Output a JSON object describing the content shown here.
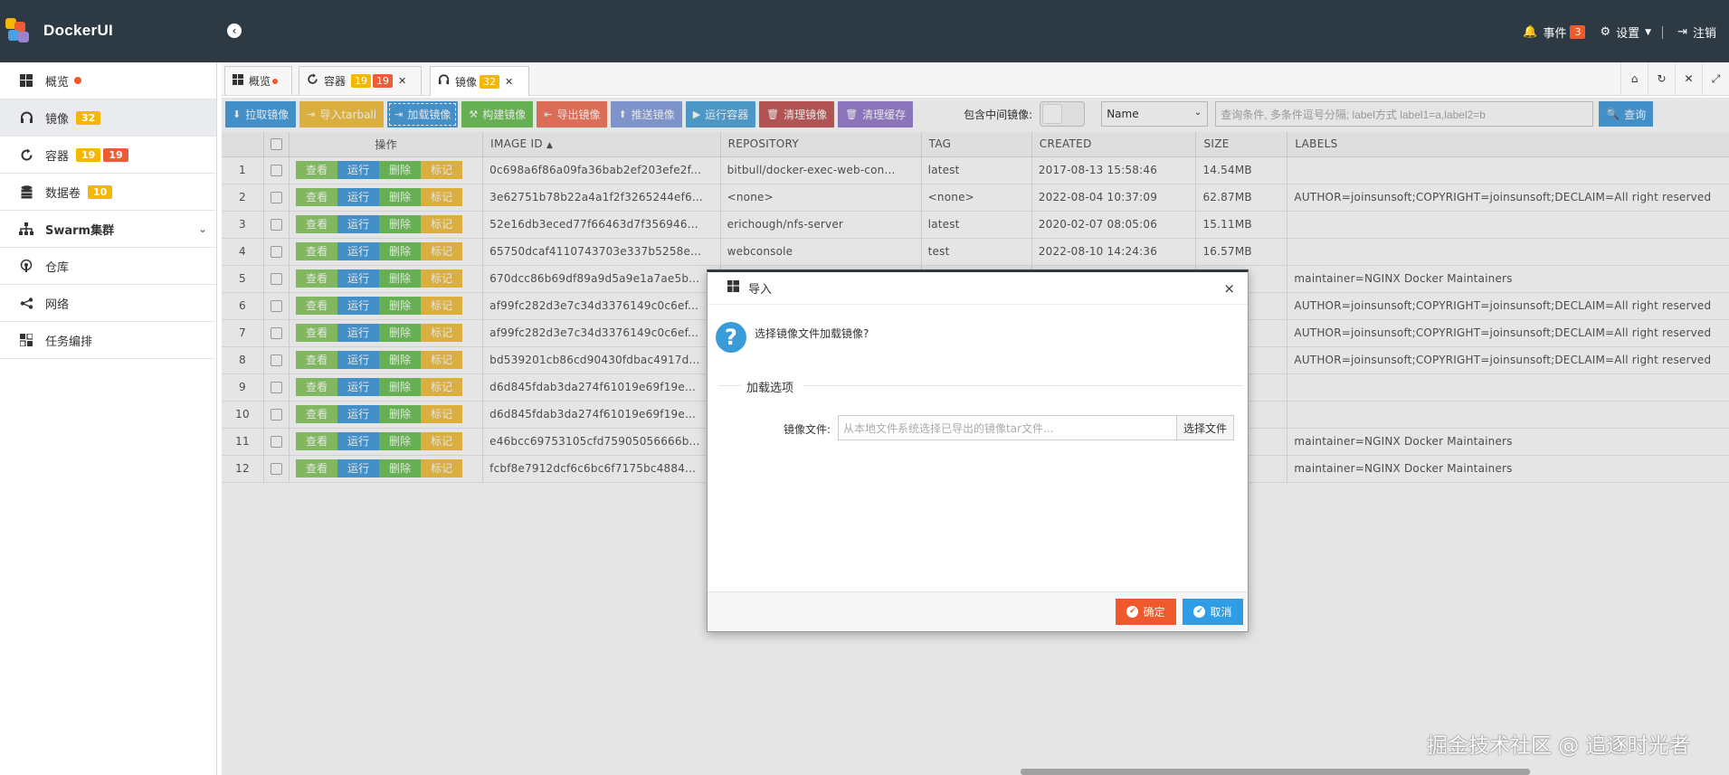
{
  "app": {
    "title": "DockerUI"
  },
  "header": {
    "events_label": "事件",
    "events_count": "3",
    "settings_label": "设置",
    "logout_label": "注销"
  },
  "sidebar": {
    "items": [
      {
        "label": "概览",
        "icon": "windows-icon"
      },
      {
        "label": "镜像",
        "icon": "headphones-icon",
        "badge": "32"
      },
      {
        "label": "容器",
        "icon": "refresh-circle-icon",
        "badge1": "19",
        "badge2": "19"
      },
      {
        "label": "数据卷",
        "icon": "database-icon",
        "badge": "10"
      },
      {
        "label": "Swarm集群",
        "icon": "sitemap-icon"
      },
      {
        "label": "仓库",
        "icon": "podcast-icon"
      },
      {
        "label": "网络",
        "icon": "share-icon"
      },
      {
        "label": "任务编排",
        "icon": "tasks-icon"
      }
    ]
  },
  "tabs": [
    {
      "label": "概览"
    },
    {
      "label": "容器",
      "badge1": "19",
      "badge2": "19"
    },
    {
      "label": "镜像",
      "badge": "32"
    }
  ],
  "toolbar": {
    "buttons": [
      "拉取镜像",
      "导入tarball",
      "加载镜像",
      "构建镜像",
      "导出镜像",
      "推送镜像",
      "运行容器",
      "清理镜像",
      "清理缓存"
    ],
    "include_intermediate_label": "包含中间镜像:",
    "filter_select": "Name",
    "query_placeholder": "查询条件, 多条件逗号分隔; label方式 label1=a,label2=b",
    "query_button": "查询"
  },
  "table": {
    "headers": [
      "操作",
      "IMAGE ID",
      "REPOSITORY",
      "TAG",
      "CREATED",
      "SIZE",
      "LABELS"
    ],
    "sort_indicator": "▲",
    "actions": [
      "查看",
      "运行",
      "删除",
      "标记"
    ],
    "rows": [
      [
        "1",
        "0c698a6f86a09fa36bab2ef203efe2f...",
        "bitbull/docker-exec-web-con...",
        "latest",
        "2017-08-13 15:58:46",
        "14.54MB",
        ""
      ],
      [
        "2",
        "3e62751b78b22a4a1f2f3265244ef6...",
        "<none>",
        "<none>",
        "2022-08-04 10:37:09",
        "62.87MB",
        "AUTHOR=joinsunsoft;COPYRIGHT=joinsunsoft;DECLAIM=All right reserved"
      ],
      [
        "3",
        "52e16db3eced77f66463d7f356946...",
        "erichough/nfs-server",
        "latest",
        "2020-02-07 08:05:06",
        "15.11MB",
        ""
      ],
      [
        "4",
        "65750dcaf4110743703e337b5258e...",
        "webconsole",
        "test",
        "2022-08-10 14:24:36",
        "16.57MB",
        ""
      ],
      [
        "5",
        "670dcc86b69df89a9d5a9e1a7ae5b...",
        "",
        "",
        "",
        "",
        "maintainer=NGINX Docker Maintainers"
      ],
      [
        "6",
        "af99fc282d3e7c34d3376149c0c6ef...",
        "",
        "",
        "",
        "",
        "AUTHOR=joinsunsoft;COPYRIGHT=joinsunsoft;DECLAIM=All right reserved"
      ],
      [
        "7",
        "af99fc282d3e7c34d3376149c0c6ef...",
        "",
        "",
        "",
        "",
        "AUTHOR=joinsunsoft;COPYRIGHT=joinsunsoft;DECLAIM=All right reserved"
      ],
      [
        "8",
        "bd539201cb86cd90430fdbac4917d...",
        "",
        "",
        "",
        "",
        "AUTHOR=joinsunsoft;COPYRIGHT=joinsunsoft;DECLAIM=All right reserved"
      ],
      [
        "9",
        "d6d845fdab3da274f61019e69f19e...",
        "",
        "",
        "",
        "",
        ""
      ],
      [
        "10",
        "d6d845fdab3da274f61019e69f19e...",
        "",
        "",
        "",
        "",
        ""
      ],
      [
        "11",
        "e46bcc69753105cfd75905056666b...",
        "",
        "",
        "",
        "",
        "maintainer=NGINX Docker Maintainers"
      ],
      [
        "12",
        "fcbf8e7912dcf6c6bc6f7175bc4884...",
        "",
        "",
        "",
        "",
        "maintainer=NGINX Docker Maintainers"
      ]
    ]
  },
  "modal": {
    "title": "导入",
    "question": "选择镜像文件加载镜像?",
    "legend": "加载选项",
    "file_label": "镜像文件:",
    "file_placeholder": "从本地文件系统选择已导出的镜像tar文件...",
    "choose_button": "选择文件",
    "ok_button": "确定",
    "cancel_button": "取消"
  },
  "watermark": "掘金技术社区 @ 追逐时光者",
  "colors": {
    "header_bg": "#2d3a44",
    "accent_blue": "#4ba1e0",
    "badge_yellow": "#f5b800",
    "badge_red": "#ec5d35"
  }
}
